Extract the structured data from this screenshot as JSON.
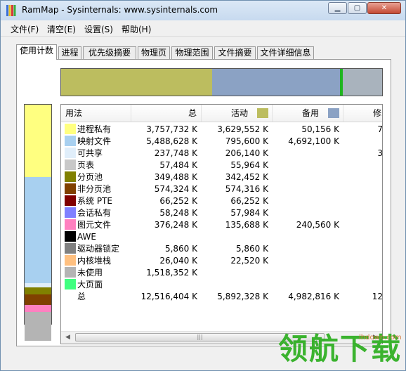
{
  "window": {
    "title": "RamMap - Sysinternals: www.sysinternals.com"
  },
  "menu": [
    "文件(F)",
    "清空(E)",
    "设置(S)",
    "帮助(H)"
  ],
  "tabs": [
    "使用计数",
    "进程",
    "优先级摘要",
    "物理页",
    "物理范围",
    "文件摘要",
    "文件详细信息"
  ],
  "columns": {
    "usage": "用法",
    "total": "总",
    "active": "活动",
    "standby": "备用",
    "modified": "修改"
  },
  "colors": {
    "active": "#bcbd5f",
    "standby": "#8ba2c4",
    "modified": "#1fb51f",
    "other": "#a9b3bd"
  },
  "summary_bar": [
    {
      "name": "active",
      "fraction": 0.471,
      "color": "#bcbd5f"
    },
    {
      "name": "standby",
      "fraction": 0.398,
      "color": "#8ba2c4"
    },
    {
      "name": "modified",
      "fraction": 0.008,
      "color": "#1fb51f"
    },
    {
      "name": "other",
      "fraction": 0.123,
      "color": "#a9b3bd"
    }
  ],
  "rows": [
    {
      "label": "进程私有",
      "color": "#ffff80",
      "total": "3,757,732 K",
      "active": "3,629,552 K",
      "standby": "50,156 K",
      "modified": "7"
    },
    {
      "label": "映射文件",
      "color": "#a8d0f0",
      "total": "5,488,628 K",
      "active": "795,600 K",
      "standby": "4,692,100 K",
      "modified": ""
    },
    {
      "label": "可共享",
      "color": "#e0eefa",
      "total": "237,748 K",
      "active": "206,140 K",
      "standby": "",
      "modified": "3"
    },
    {
      "label": "页表",
      "color": "#c8c8c8",
      "total": "57,484 K",
      "active": "55,964 K",
      "standby": "",
      "modified": ""
    },
    {
      "label": "分页池",
      "color": "#808000",
      "total": "349,488 K",
      "active": "342,452 K",
      "standby": "",
      "modified": ""
    },
    {
      "label": "非分页池",
      "color": "#804000",
      "total": "574,324 K",
      "active": "574,316 K",
      "standby": "",
      "modified": ""
    },
    {
      "label": "系统 PTE",
      "color": "#800000",
      "total": "66,252 K",
      "active": "66,252 K",
      "standby": "",
      "modified": ""
    },
    {
      "label": "会话私有",
      "color": "#8080ff",
      "total": "58,248 K",
      "active": "57,984 K",
      "standby": "",
      "modified": ""
    },
    {
      "label": "图元文件",
      "color": "#ff80c0",
      "total": "376,248 K",
      "active": "135,688 K",
      "standby": "240,560 K",
      "modified": ""
    },
    {
      "label": "AWE",
      "color": "#000000",
      "total": "",
      "active": "",
      "standby": "",
      "modified": ""
    },
    {
      "label": "驱动器锁定",
      "color": "#808080",
      "total": "5,860 K",
      "active": "5,860 K",
      "standby": "",
      "modified": ""
    },
    {
      "label": "内核堆栈",
      "color": "#ffc080",
      "total": "26,040 K",
      "active": "22,520 K",
      "standby": "",
      "modified": ""
    },
    {
      "label": "未使用",
      "color": "#b4b4b4",
      "total": "1,518,352 K",
      "active": "",
      "standby": "",
      "modified": ""
    },
    {
      "label": "大页面",
      "color": "#40ff80",
      "total": "",
      "active": "",
      "standby": "",
      "modified": ""
    },
    {
      "label": "总",
      "color": "",
      "total": "12,516,404 K",
      "active": "5,892,328 K",
      "standby": "4,982,816 K",
      "modified": "12"
    }
  ],
  "usage_bar": [
    {
      "name": "进程私有",
      "fraction": 0.331,
      "color": "#ffff80"
    },
    {
      "name": "映射文件",
      "fraction": 0.484,
      "color": "#a8d0f0"
    },
    {
      "name": "可共享",
      "fraction": 0.019,
      "color": "#e0eefa"
    },
    {
      "name": "分页池",
      "fraction": 0.03,
      "color": "#808000"
    },
    {
      "name": "非分页池",
      "fraction": 0.048,
      "color": "#804000"
    },
    {
      "name": "图元文件",
      "fraction": 0.035,
      "color": "#ff80c0"
    },
    {
      "name": "未使用",
      "fraction": 0.13,
      "color": "#b4b4b4"
    }
  ],
  "watermark": {
    "text": "领航下载",
    "url": "lhdown.com"
  }
}
